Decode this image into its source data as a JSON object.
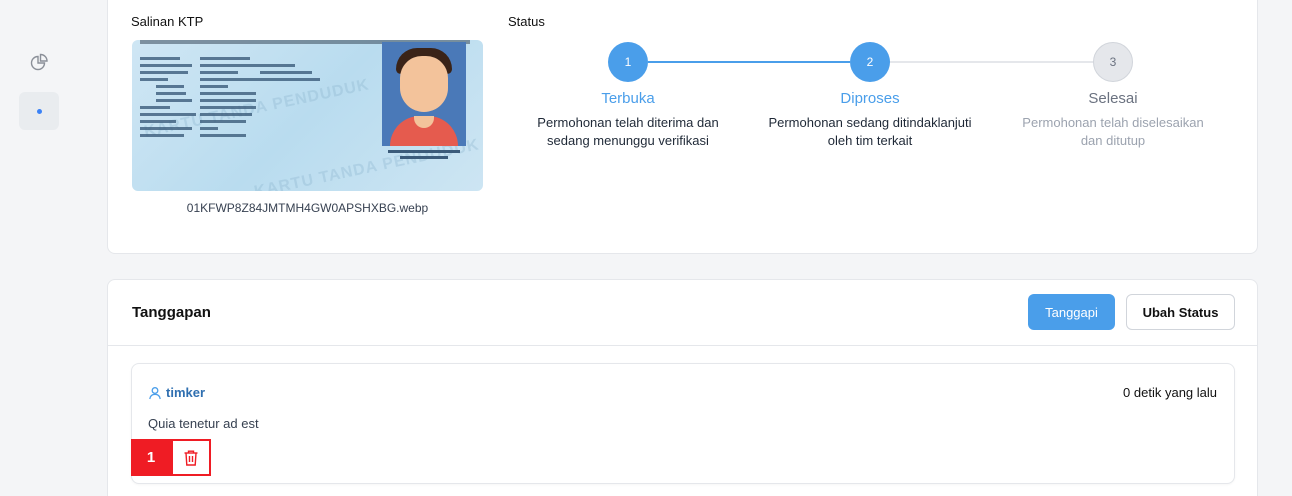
{
  "sidebar": {
    "icons": [
      "pie-chart-icon",
      "dot-icon"
    ]
  },
  "ktp": {
    "label": "Salinan KTP",
    "filename": "01KFWP8Z84JMTMH4GW0APSHXBG.webp",
    "watermark": "KARTU TANDA PENDUDUK"
  },
  "status": {
    "label": "Status",
    "steps": [
      {
        "number": "1",
        "title": "Terbuka",
        "desc_line1": "Permohonan telah diterima dan",
        "desc_line2": "sedang menunggu verifikasi",
        "state": "done"
      },
      {
        "number": "2",
        "title": "Diproses",
        "desc_line1": "Permohonan sedang ditindaklanjuti",
        "desc_line2": "oleh tim terkait",
        "state": "active"
      },
      {
        "number": "3",
        "title": "Selesai",
        "desc_line1": "Permohonan telah diselesaikan",
        "desc_line2": "dan ditutup",
        "state": "pending"
      }
    ]
  },
  "tanggapan": {
    "title": "Tanggapan",
    "btn_reply": "Tanggapi",
    "btn_change_status": "Ubah Status",
    "comment": {
      "author": "timker",
      "time": "0 detik yang lalu",
      "body": "Quia tenetur ad est",
      "badge": "1"
    }
  },
  "colors": {
    "accent": "#4a9eea",
    "accent_text": "#2f6fb0",
    "inactive": "#9ca3af",
    "highlight": "#ef1c24"
  }
}
